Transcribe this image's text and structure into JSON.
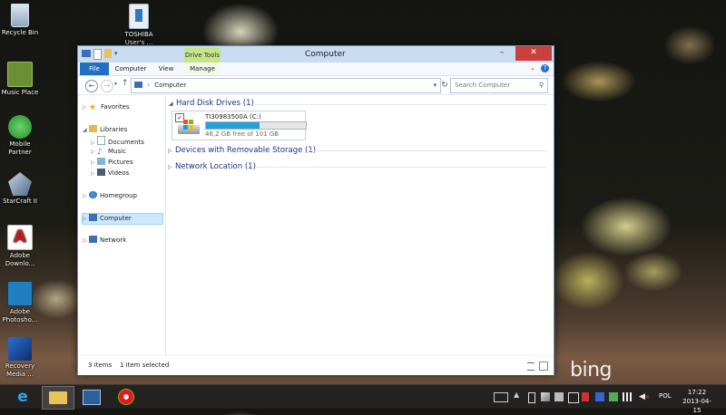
{
  "desktop": {
    "icons": [
      {
        "label": "Recycle Bin",
        "icon": "recycle-bin-icon"
      },
      {
        "label": "TOSHIBA User's ...",
        "icon": "document-shortcut-icon"
      },
      {
        "label": "Music Place",
        "icon": "music-place-icon"
      },
      {
        "label": "Mobile Partner",
        "icon": "mobile-partner-icon"
      },
      {
        "label": "StarCraft II",
        "icon": "starcraft-icon"
      },
      {
        "label": "Adobe Downlo...",
        "icon": "adobe-download-icon"
      },
      {
        "label": "Adobe Photosho...",
        "icon": "photoshop-icon"
      },
      {
        "label": "Recovery Media ...",
        "icon": "recovery-media-icon"
      }
    ],
    "wallpaper_logo": "bing"
  },
  "window": {
    "title": "Computer",
    "contextual_tab": "Drive Tools",
    "ribbon_tabs": [
      "File",
      "Computer",
      "View",
      "Manage"
    ],
    "address": "Computer",
    "search_placeholder": "Search Computer",
    "nav": {
      "favorites": "Favorites",
      "libraries": "Libraries",
      "library_items": [
        "Documents",
        "Music",
        "Pictures",
        "Videos"
      ],
      "homegroup": "Homegroup",
      "computer": "Computer",
      "network": "Network"
    },
    "groups": [
      {
        "title": "Hard Disk Drives (1)"
      },
      {
        "title": "Devices with Removable Storage (1)"
      },
      {
        "title": "Network Location (1)"
      }
    ],
    "drive": {
      "name": "TI30983500A (C:)",
      "free_text": "46,2 GB free of 101 GB",
      "used_fraction": 0.54
    },
    "status": {
      "items": "3 items",
      "selected": "1 item selected"
    }
  },
  "taskbar": {
    "language": "POL",
    "time": "17:22",
    "date": "2013-04-15"
  },
  "colors": {
    "accent": "#1f6fc5",
    "drive_fill": "#26a0da",
    "close": "#c8413a",
    "context_tab": "#c6e58a"
  }
}
